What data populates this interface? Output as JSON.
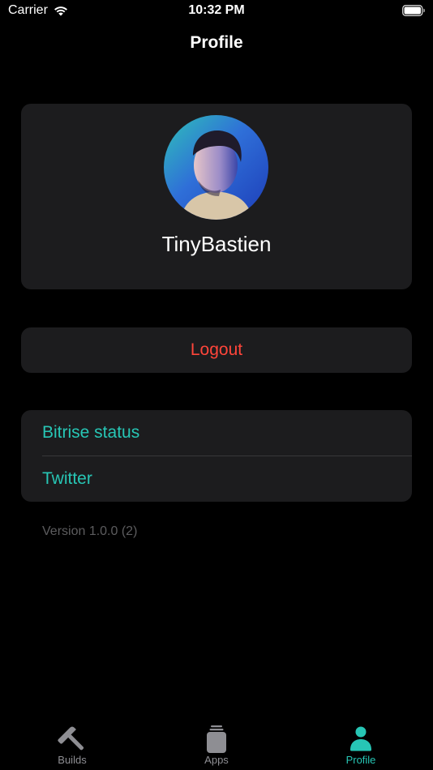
{
  "status_bar": {
    "carrier": "Carrier",
    "time": "10:32 PM"
  },
  "nav": {
    "title": "Profile"
  },
  "profile": {
    "username": "TinyBastien"
  },
  "actions": {
    "logout_label": "Logout"
  },
  "links": [
    {
      "label": "Bitrise status"
    },
    {
      "label": "Twitter"
    }
  ],
  "version_text": "Version 1.0.0 (2)",
  "tabs": [
    {
      "label": "Builds",
      "icon": "hammer-icon",
      "active": false
    },
    {
      "label": "Apps",
      "icon": "stack-icon",
      "active": false
    },
    {
      "label": "Profile",
      "icon": "person-icon",
      "active": true
    }
  ],
  "colors": {
    "accent": "#27c6b5",
    "destructive": "#ff453a",
    "card_background": "#1c1c1e",
    "background": "#000000",
    "inactive_tab": "#8e8e93"
  }
}
